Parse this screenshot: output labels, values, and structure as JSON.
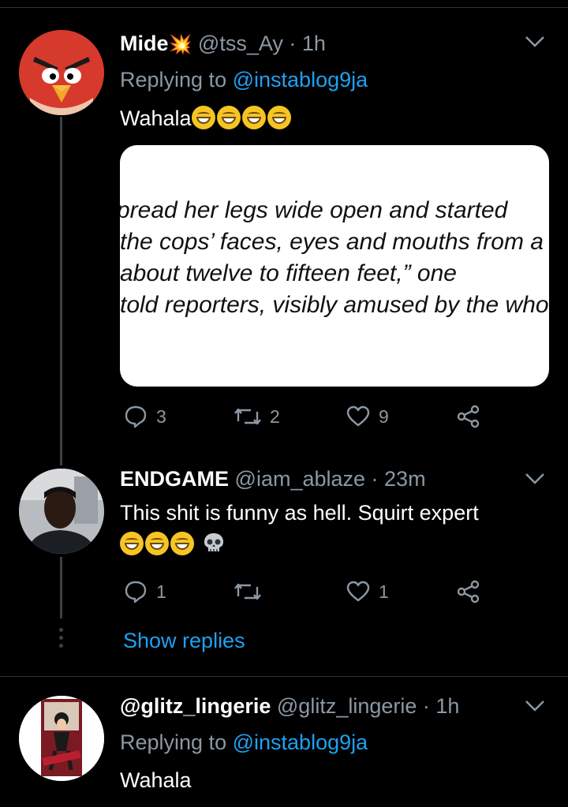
{
  "tweets": [
    {
      "name": "Mide",
      "name_emoji": "💥",
      "handle": "@tss_Ay",
      "time": "· 1h",
      "replying_label": "Replying to",
      "replying_to": "@instablog9ja",
      "text": "Wahala",
      "text_emojis": [
        "😁",
        "😁",
        "😁",
        "😁"
      ],
      "card_lines": [
        "pread her legs wide open and started",
        " the cops’ faces, eyes and mouths from a",
        " about twelve to fifteen feet,” one",
        " told reporters, visibly amused by the who"
      ],
      "replies": "3",
      "retweets": "2",
      "likes": "9"
    },
    {
      "name": "ENDGAME",
      "handle": "@iam_ablaze",
      "time": "· 23m",
      "text": "This shit is funny as hell. Squirt expert",
      "text_emojis": [
        "😁",
        "😁",
        "😁",
        "💀"
      ],
      "replies": "1",
      "retweets": "",
      "likes": "1"
    },
    {
      "name": "@glitz_lingerie",
      "handle": "@glitz_lingerie",
      "time": "· 1h",
      "replying_label": "Replying to",
      "replying_to": "@instablog9ja",
      "text": "Wahala",
      "avatar_text": "glitz_Lingerie"
    }
  ],
  "show_replies": "Show replies",
  "icons": {
    "reply": "reply-icon",
    "retweet": "retweet-icon",
    "like": "heart-icon",
    "share": "share-icon",
    "more": "chevron-down-icon"
  },
  "colors": {
    "background": "#000000",
    "link": "#1da1f2",
    "secondary_text": "#8b98a5",
    "angry_bird_red": "#d9382b"
  }
}
